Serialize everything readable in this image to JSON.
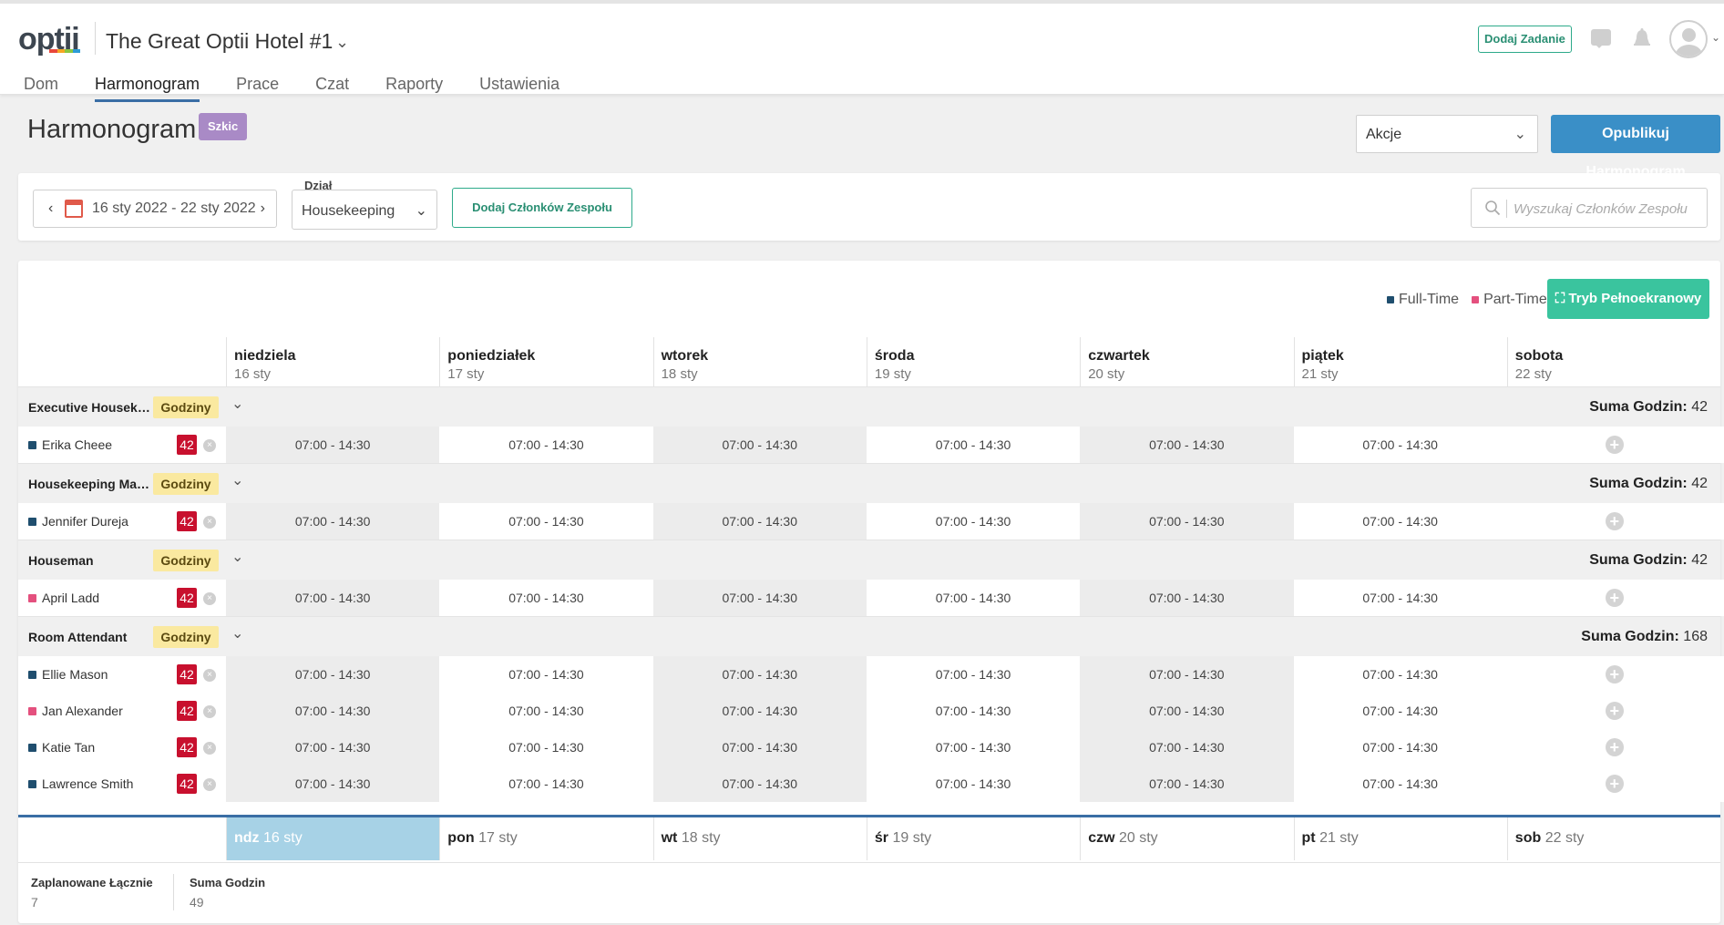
{
  "app": {
    "logo_text": "optii",
    "logo_colors": [
      "#e8473c",
      "#f6a623",
      "#8cc63f",
      "#2d9bd6"
    ],
    "hotel_name": "The Great Optii Hotel #1",
    "add_task_label": "Dodaj Zadanie"
  },
  "nav": {
    "tabs": [
      "Dom",
      "Harmonogram",
      "Prace",
      "Czat",
      "Raporty",
      "Ustawienia"
    ],
    "active": "Harmonogram"
  },
  "page": {
    "title": "Harmonogram",
    "status_badge": "Szkic",
    "actions_label": "Akcje",
    "publish_label": "Opublikuj Harmonogram"
  },
  "filters": {
    "date_range": "16 sty 2022 - 22 sty 2022",
    "department_label": "Dział",
    "department_value": "Housekeeping",
    "add_members_label": "Dodaj Członków Zespołu",
    "search_placeholder": "Wyszukaj Członków Zespołu"
  },
  "legend": {
    "full_time": "Full-Time",
    "part_time": "Part-Time",
    "full_time_color": "#1f4e6e",
    "part_time_color": "#e4507e",
    "fullscreen_label": "Tryb Pełnoekranowy"
  },
  "days": [
    {
      "name": "niedziela",
      "date": "16 sty",
      "short": "ndz",
      "footer_date": "16 sty"
    },
    {
      "name": "poniedziałek",
      "date": "17 sty",
      "short": "pon",
      "footer_date": "17 sty"
    },
    {
      "name": "wtorek",
      "date": "18 sty",
      "short": "wt",
      "footer_date": "18 sty"
    },
    {
      "name": "środa",
      "date": "19 sty",
      "short": "śr",
      "footer_date": "19 sty"
    },
    {
      "name": "czwartek",
      "date": "20 sty",
      "short": "czw",
      "footer_date": "20 sty"
    },
    {
      "name": "piątek",
      "date": "21 sty",
      "short": "pt",
      "footer_date": "21 sty"
    },
    {
      "name": "sobota",
      "date": "22 sty",
      "short": "sob",
      "footer_date": "22 sty"
    }
  ],
  "hours_pill_label": "Godziny",
  "total_label": "Suma Godzin:",
  "groups": [
    {
      "name": "Executive Housekee...",
      "total": "42",
      "employees": [
        {
          "name": "Erika Cheee",
          "type": "full",
          "hours": "42",
          "shifts": [
            "07:00 - 14:30",
            "07:00 - 14:30",
            "07:00 - 14:30",
            "07:00 - 14:30",
            "07:00 - 14:30",
            "07:00 - 14:30",
            ""
          ]
        }
      ]
    },
    {
      "name": "Housekeeping Man...",
      "total": "42",
      "employees": [
        {
          "name": "Jennifer Dureja",
          "type": "full",
          "hours": "42",
          "shifts": [
            "07:00 - 14:30",
            "07:00 - 14:30",
            "07:00 - 14:30",
            "07:00 - 14:30",
            "07:00 - 14:30",
            "07:00 - 14:30",
            ""
          ]
        }
      ]
    },
    {
      "name": "Houseman",
      "total": "42",
      "employees": [
        {
          "name": "April Ladd",
          "type": "part",
          "hours": "42",
          "shifts": [
            "07:00 - 14:30",
            "07:00 - 14:30",
            "07:00 - 14:30",
            "07:00 - 14:30",
            "07:00 - 14:30",
            "07:00 - 14:30",
            ""
          ]
        }
      ]
    },
    {
      "name": "Room Attendant",
      "total": "168",
      "employees": [
        {
          "name": "Ellie Mason",
          "type": "full",
          "hours": "42",
          "shifts": [
            "07:00 - 14:30",
            "07:00 - 14:30",
            "07:00 - 14:30",
            "07:00 - 14:30",
            "07:00 - 14:30",
            "07:00 - 14:30",
            ""
          ]
        },
        {
          "name": "Jan Alexander",
          "type": "part",
          "hours": "42",
          "shifts": [
            "07:00 - 14:30",
            "07:00 - 14:30",
            "07:00 - 14:30",
            "07:00 - 14:30",
            "07:00 - 14:30",
            "07:00 - 14:30",
            ""
          ]
        },
        {
          "name": "Katie Tan",
          "type": "full",
          "hours": "42",
          "shifts": [
            "07:00 - 14:30",
            "07:00 - 14:30",
            "07:00 - 14:30",
            "07:00 - 14:30",
            "07:00 - 14:30",
            "07:00 - 14:30",
            ""
          ]
        },
        {
          "name": "Lawrence Smith",
          "type": "full",
          "hours": "42",
          "shifts": [
            "07:00 - 14:30",
            "07:00 - 14:30",
            "07:00 - 14:30",
            "07:00 - 14:30",
            "07:00 - 14:30",
            "07:00 - 14:30",
            ""
          ]
        }
      ]
    }
  ],
  "selected_day": "ndz",
  "summary": {
    "scheduled_label": "Zaplanowane Łącznie",
    "scheduled_value": "7",
    "hours_label": "Suma Godzin",
    "hours_value": "49"
  }
}
